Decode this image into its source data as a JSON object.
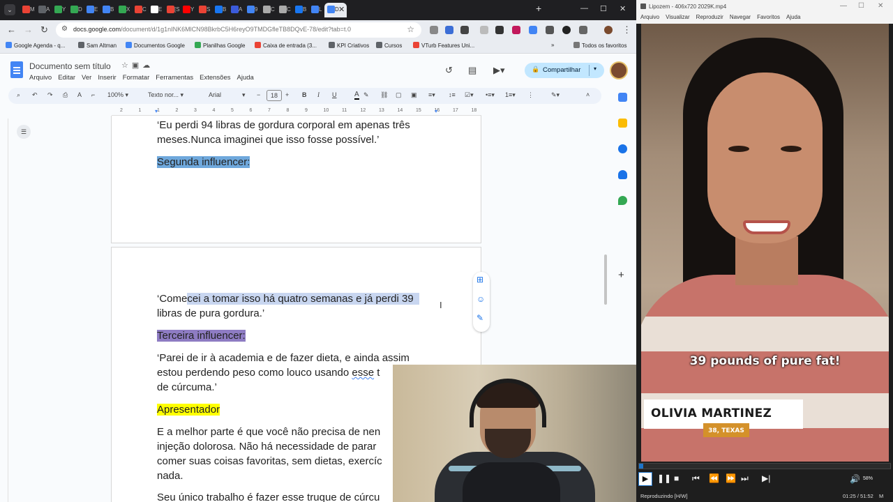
{
  "browser": {
    "tabs": [
      {
        "label": "M",
        "color": "#ea4335"
      },
      {
        "label": "A",
        "color": "#5f6368"
      },
      {
        "label": "Y",
        "color": "#34a853"
      },
      {
        "label": "D",
        "color": "#34a853"
      },
      {
        "label": "E",
        "color": "#4285f4"
      },
      {
        "label": "B",
        "color": "#4285f4"
      },
      {
        "label": "X",
        "color": "#34a853"
      },
      {
        "label": "C",
        "color": "#ea4335"
      },
      {
        "label": "E",
        "color": "#ffffff"
      },
      {
        "label": "[S",
        "color": "#ea4335"
      },
      {
        "label": "Y",
        "color": "#ff0000"
      },
      {
        "label": "S",
        "color": "#ea4335"
      },
      {
        "label": "B",
        "color": "#1877f2"
      },
      {
        "label": "A",
        "color": "#3b5bdb"
      },
      {
        "label": "9",
        "color": "#4285f4"
      },
      {
        "label": "C",
        "color": "#aaaaaa"
      },
      {
        "label": "C",
        "color": "#aaaaaa"
      },
      {
        "label": "B",
        "color": "#1877f2"
      },
      {
        "label": "L",
        "color": "#4285f4"
      }
    ],
    "active_tab": {
      "label": "D",
      "color": "#4285f4"
    },
    "url_main": "docs.google.com",
    "url_rest": "/document/d/1g1nINK6MlCN98BkrbC5H6reyO9TMDGfleTB8DQvE-78/edit?tab=t.0",
    "bookmarks": [
      {
        "label": "Google Agenda - q...",
        "color": "#4285f4"
      },
      {
        "label": "Sam Altman",
        "color": "#5f6368"
      },
      {
        "label": "Documentos Google",
        "color": "#4285f4"
      },
      {
        "label": "Planilhas Google",
        "color": "#34a853"
      },
      {
        "label": "Caixa de entrada (3...",
        "color": "#ea4335"
      },
      {
        "label": "KPI Criativos",
        "color": "#5f6368"
      },
      {
        "label": "Cursos",
        "color": "#5f6368"
      },
      {
        "label": "VTurb Features Uni...",
        "color": "#ea4335"
      }
    ],
    "bookmarks_overflow": "»",
    "all_bookmarks": "Todos os favoritos"
  },
  "docs": {
    "title": "Documento sem título",
    "menu": [
      "Arquivo",
      "Editar",
      "Ver",
      "Inserir",
      "Formatar",
      "Ferramentas",
      "Extensões",
      "Ajuda"
    ],
    "share_label": "Compartilhar",
    "zoom": "100%",
    "style": "Texto nor...",
    "font": "Arial",
    "font_size": "18",
    "ruler_nums": [
      "2",
      "1",
      "1",
      "2",
      "3",
      "4",
      "5",
      "6",
      "7",
      "8",
      "9",
      "10",
      "11",
      "12",
      "13",
      "14",
      "15",
      "16",
      "17",
      "18"
    ],
    "page1": {
      "quote1_line1": "‘Eu perdi 94 libras de gordura corporal em apenas três",
      "quote1_line2": "meses.Nunca imaginei que isso fosse possível.’",
      "heading2": "Segunda influencer:"
    },
    "page2": {
      "quote2_pre": "‘Come",
      "quote2_sel": "cei a tomar isso há quatro semanas e já perdi 39",
      "quote2_line2": "libras de pura gordura.’",
      "heading3": "Terceira influencer:",
      "quote3_line1": "‘Parei de ir à academia e de fazer dieta, e ainda assim",
      "quote3_line2a": "estou perdendo peso como louco usando ",
      "quote3_line2b": "esse",
      "quote3_line2c": " t",
      "quote3_line3": "de cúrcuma.’",
      "heading4": "Apresentador",
      "para1": "E a melhor parte é que você não precisa de nen",
      "para2": "injeção dolorosa. Não há necessidade de parar",
      "para3": "comer suas coisas favoritas, sem dietas, exercíc",
      "para4": "nada.",
      "para5": "Seu único trabalho é fazer esse truque de cúrcu"
    }
  },
  "player": {
    "window_title": "Lipozem - 406x720 2029K.mp4",
    "menu": [
      "Arquivo",
      "Visualizar",
      "Reproduzir",
      "Navegar",
      "Favoritos",
      "Ajuda"
    ],
    "caption": "39 pounds of pure fat!",
    "name": "OLIVIA MARTINEZ",
    "location": "38, TEXAS",
    "progress_fraction": 0.016,
    "volume": "58%",
    "status": "Reproduzindo [H/W]",
    "time": "01:25 / 51:52",
    "status_right": "M"
  }
}
